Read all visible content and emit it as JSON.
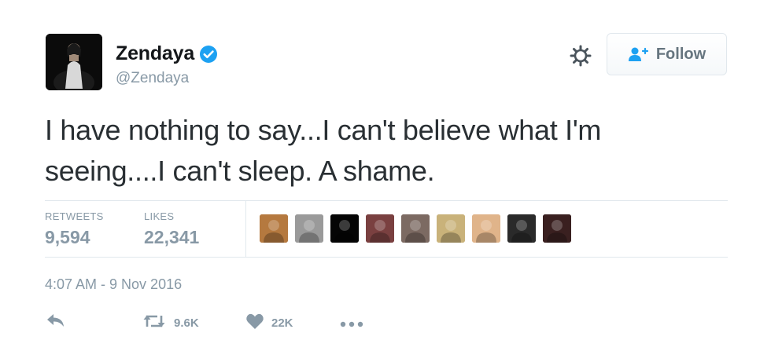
{
  "user": {
    "display_name": "Zendaya",
    "handle": "@Zendaya",
    "verified": true,
    "avatar_icon": "profile-photo"
  },
  "header": {
    "settings_icon": "gear-icon",
    "follow_label": "Follow",
    "follow_icon": "person-plus-icon"
  },
  "tweet": {
    "text": "I have nothing to say...I can't believe what I'm seeing....I can't sleep. A shame."
  },
  "stats": {
    "retweets_label": "RETWEETS",
    "retweets_value": "9,594",
    "likes_label": "LIKES",
    "likes_value": "22,341"
  },
  "likers": [
    {
      "icon": "liker-avatar",
      "color": "#b5793f"
    },
    {
      "icon": "liker-avatar",
      "color": "#9a9a9a"
    },
    {
      "icon": "liker-avatar",
      "color": "#050505"
    },
    {
      "icon": "liker-avatar",
      "color": "#7a4040"
    },
    {
      "icon": "liker-avatar",
      "color": "#7c6a62"
    },
    {
      "icon": "liker-avatar",
      "color": "#c9b27a"
    },
    {
      "icon": "liker-avatar",
      "color": "#e0b48a"
    },
    {
      "icon": "liker-avatar",
      "color": "#2a2a2a"
    },
    {
      "icon": "liker-avatar",
      "color": "#3a2020"
    }
  ],
  "timestamp": "4:07 AM - 9 Nov 2016",
  "actions": {
    "reply_icon": "reply-icon",
    "retweet_icon": "retweet-icon",
    "retweet_count": "9.6K",
    "like_icon": "heart-icon",
    "like_count": "22K",
    "more_icon": "more-icon"
  },
  "colors": {
    "verified_blue": "#1da1f2",
    "muted_text": "#8899a6",
    "body_text": "#292f33",
    "divider": "#e1e8ed"
  }
}
